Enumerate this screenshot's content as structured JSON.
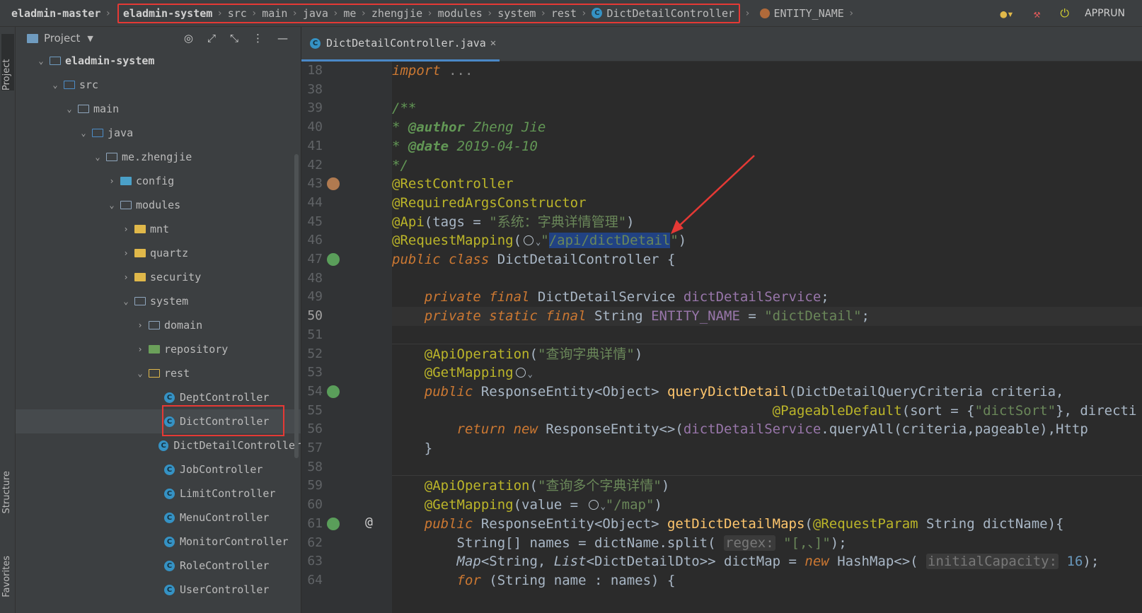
{
  "breadcrumb": {
    "root": "eladmin-master",
    "items": [
      "eladmin-system",
      "src",
      "main",
      "java",
      "me",
      "zhengjie",
      "modules",
      "system",
      "rest",
      "DictDetailController"
    ],
    "after": "ENTITY_NAME"
  },
  "toolbar": {
    "apprun": "APPRUN"
  },
  "side_strip": {
    "project": "Project",
    "structure": "Structure",
    "favorites": "Favorites"
  },
  "project_panel": {
    "title": "Project",
    "tree": [
      {
        "label": "eladmin-system",
        "bold": true
      },
      {
        "label": "src"
      },
      {
        "label": "main"
      },
      {
        "label": "java"
      },
      {
        "label": "me.zhengjie"
      },
      {
        "label": "config"
      },
      {
        "label": "modules"
      },
      {
        "label": "mnt"
      },
      {
        "label": "quartz"
      },
      {
        "label": "security"
      },
      {
        "label": "system"
      },
      {
        "label": "domain"
      },
      {
        "label": "repository"
      },
      {
        "label": "rest"
      },
      {
        "label": "DeptController"
      },
      {
        "label": "DictController"
      },
      {
        "label": "DictDetailController"
      },
      {
        "label": "JobController"
      },
      {
        "label": "LimitController"
      },
      {
        "label": "MenuController"
      },
      {
        "label": "MonitorController"
      },
      {
        "label": "RoleController"
      },
      {
        "label": "UserController"
      }
    ]
  },
  "editor": {
    "tab": "DictDetailController.java",
    "line_numbers": [
      "18",
      "38",
      "39",
      "40",
      "41",
      "42",
      "43",
      "44",
      "45",
      "46",
      "47",
      "48",
      "49",
      "50",
      "51",
      "52",
      "53",
      "54",
      "55",
      "56",
      "57",
      "58",
      "59",
      "60",
      "61",
      "62",
      "63",
      "64"
    ],
    "current_line": "50"
  }
}
